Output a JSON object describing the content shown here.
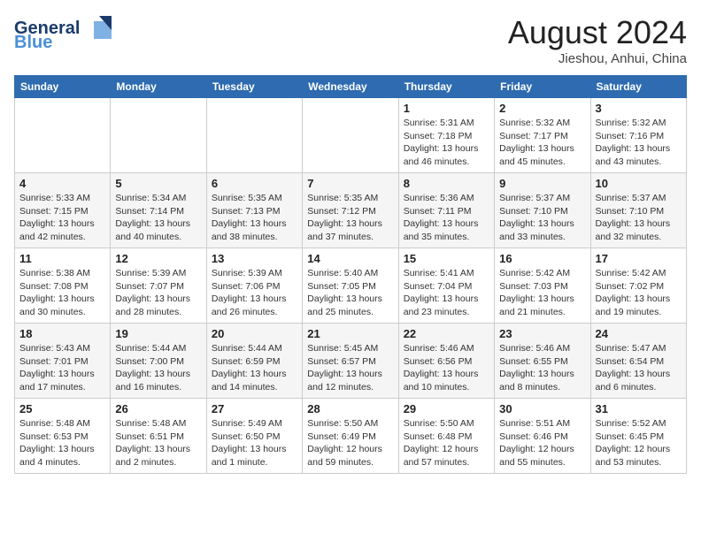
{
  "logo": {
    "general": "General",
    "blue": "Blue"
  },
  "title": "August 2024",
  "location": "Jieshou, Anhui, China",
  "days_header": [
    "Sunday",
    "Monday",
    "Tuesday",
    "Wednesday",
    "Thursday",
    "Friday",
    "Saturday"
  ],
  "weeks": [
    [
      {
        "day": "",
        "info": ""
      },
      {
        "day": "",
        "info": ""
      },
      {
        "day": "",
        "info": ""
      },
      {
        "day": "",
        "info": ""
      },
      {
        "day": "1",
        "sunrise": "Sunrise: 5:31 AM",
        "sunset": "Sunset: 7:18 PM",
        "daylight": "Daylight: 13 hours and 46 minutes."
      },
      {
        "day": "2",
        "sunrise": "Sunrise: 5:32 AM",
        "sunset": "Sunset: 7:17 PM",
        "daylight": "Daylight: 13 hours and 45 minutes."
      },
      {
        "day": "3",
        "sunrise": "Sunrise: 5:32 AM",
        "sunset": "Sunset: 7:16 PM",
        "daylight": "Daylight: 13 hours and 43 minutes."
      }
    ],
    [
      {
        "day": "4",
        "sunrise": "Sunrise: 5:33 AM",
        "sunset": "Sunset: 7:15 PM",
        "daylight": "Daylight: 13 hours and 42 minutes."
      },
      {
        "day": "5",
        "sunrise": "Sunrise: 5:34 AM",
        "sunset": "Sunset: 7:14 PM",
        "daylight": "Daylight: 13 hours and 40 minutes."
      },
      {
        "day": "6",
        "sunrise": "Sunrise: 5:35 AM",
        "sunset": "Sunset: 7:13 PM",
        "daylight": "Daylight: 13 hours and 38 minutes."
      },
      {
        "day": "7",
        "sunrise": "Sunrise: 5:35 AM",
        "sunset": "Sunset: 7:12 PM",
        "daylight": "Daylight: 13 hours and 37 minutes."
      },
      {
        "day": "8",
        "sunrise": "Sunrise: 5:36 AM",
        "sunset": "Sunset: 7:11 PM",
        "daylight": "Daylight: 13 hours and 35 minutes."
      },
      {
        "day": "9",
        "sunrise": "Sunrise: 5:37 AM",
        "sunset": "Sunset: 7:10 PM",
        "daylight": "Daylight: 13 hours and 33 minutes."
      },
      {
        "day": "10",
        "sunrise": "Sunrise: 5:37 AM",
        "sunset": "Sunset: 7:10 PM",
        "daylight": "Daylight: 13 hours and 32 minutes."
      }
    ],
    [
      {
        "day": "11",
        "sunrise": "Sunrise: 5:38 AM",
        "sunset": "Sunset: 7:08 PM",
        "daylight": "Daylight: 13 hours and 30 minutes."
      },
      {
        "day": "12",
        "sunrise": "Sunrise: 5:39 AM",
        "sunset": "Sunset: 7:07 PM",
        "daylight": "Daylight: 13 hours and 28 minutes."
      },
      {
        "day": "13",
        "sunrise": "Sunrise: 5:39 AM",
        "sunset": "Sunset: 7:06 PM",
        "daylight": "Daylight: 13 hours and 26 minutes."
      },
      {
        "day": "14",
        "sunrise": "Sunrise: 5:40 AM",
        "sunset": "Sunset: 7:05 PM",
        "daylight": "Daylight: 13 hours and 25 minutes."
      },
      {
        "day": "15",
        "sunrise": "Sunrise: 5:41 AM",
        "sunset": "Sunset: 7:04 PM",
        "daylight": "Daylight: 13 hours and 23 minutes."
      },
      {
        "day": "16",
        "sunrise": "Sunrise: 5:42 AM",
        "sunset": "Sunset: 7:03 PM",
        "daylight": "Daylight: 13 hours and 21 minutes."
      },
      {
        "day": "17",
        "sunrise": "Sunrise: 5:42 AM",
        "sunset": "Sunset: 7:02 PM",
        "daylight": "Daylight: 13 hours and 19 minutes."
      }
    ],
    [
      {
        "day": "18",
        "sunrise": "Sunrise: 5:43 AM",
        "sunset": "Sunset: 7:01 PM",
        "daylight": "Daylight: 13 hours and 17 minutes."
      },
      {
        "day": "19",
        "sunrise": "Sunrise: 5:44 AM",
        "sunset": "Sunset: 7:00 PM",
        "daylight": "Daylight: 13 hours and 16 minutes."
      },
      {
        "day": "20",
        "sunrise": "Sunrise: 5:44 AM",
        "sunset": "Sunset: 6:59 PM",
        "daylight": "Daylight: 13 hours and 14 minutes."
      },
      {
        "day": "21",
        "sunrise": "Sunrise: 5:45 AM",
        "sunset": "Sunset: 6:57 PM",
        "daylight": "Daylight: 13 hours and 12 minutes."
      },
      {
        "day": "22",
        "sunrise": "Sunrise: 5:46 AM",
        "sunset": "Sunset: 6:56 PM",
        "daylight": "Daylight: 13 hours and 10 minutes."
      },
      {
        "day": "23",
        "sunrise": "Sunrise: 5:46 AM",
        "sunset": "Sunset: 6:55 PM",
        "daylight": "Daylight: 13 hours and 8 minutes."
      },
      {
        "day": "24",
        "sunrise": "Sunrise: 5:47 AM",
        "sunset": "Sunset: 6:54 PM",
        "daylight": "Daylight: 13 hours and 6 minutes."
      }
    ],
    [
      {
        "day": "25",
        "sunrise": "Sunrise: 5:48 AM",
        "sunset": "Sunset: 6:53 PM",
        "daylight": "Daylight: 13 hours and 4 minutes."
      },
      {
        "day": "26",
        "sunrise": "Sunrise: 5:48 AM",
        "sunset": "Sunset: 6:51 PM",
        "daylight": "Daylight: 13 hours and 2 minutes."
      },
      {
        "day": "27",
        "sunrise": "Sunrise: 5:49 AM",
        "sunset": "Sunset: 6:50 PM",
        "daylight": "Daylight: 13 hours and 1 minute."
      },
      {
        "day": "28",
        "sunrise": "Sunrise: 5:50 AM",
        "sunset": "Sunset: 6:49 PM",
        "daylight": "Daylight: 12 hours and 59 minutes."
      },
      {
        "day": "29",
        "sunrise": "Sunrise: 5:50 AM",
        "sunset": "Sunset: 6:48 PM",
        "daylight": "Daylight: 12 hours and 57 minutes."
      },
      {
        "day": "30",
        "sunrise": "Sunrise: 5:51 AM",
        "sunset": "Sunset: 6:46 PM",
        "daylight": "Daylight: 12 hours and 55 minutes."
      },
      {
        "day": "31",
        "sunrise": "Sunrise: 5:52 AM",
        "sunset": "Sunset: 6:45 PM",
        "daylight": "Daylight: 12 hours and 53 minutes."
      }
    ]
  ]
}
